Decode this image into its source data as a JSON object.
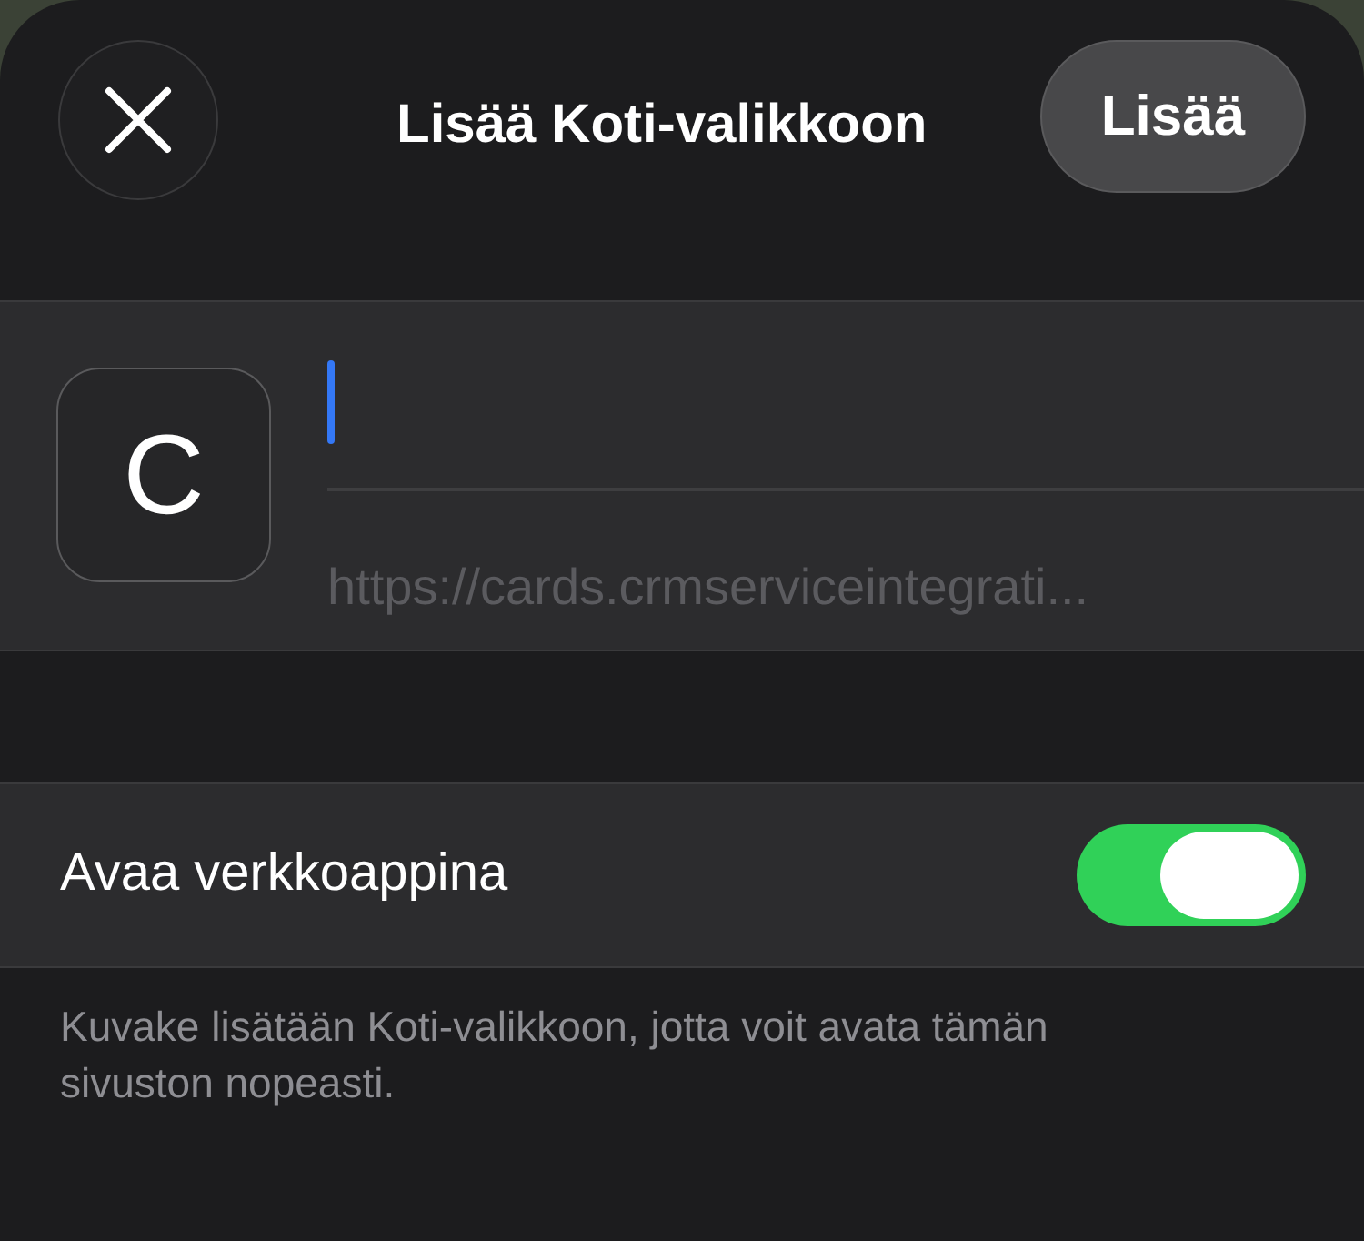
{
  "header": {
    "title": "Lisää Koti-valikkoon",
    "add_button": "Lisää"
  },
  "bookmark": {
    "icon_letter": "C",
    "name_field": {
      "focused": true
    },
    "url": "https://cards.crmserviceintegrati..."
  },
  "web_app_toggle": {
    "label": "Avaa verkkoappina",
    "on": true
  },
  "footer_note": "Kuvake lisätään Koti-valikkoon, jotta voit avata tämän sivuston nopeasti."
}
